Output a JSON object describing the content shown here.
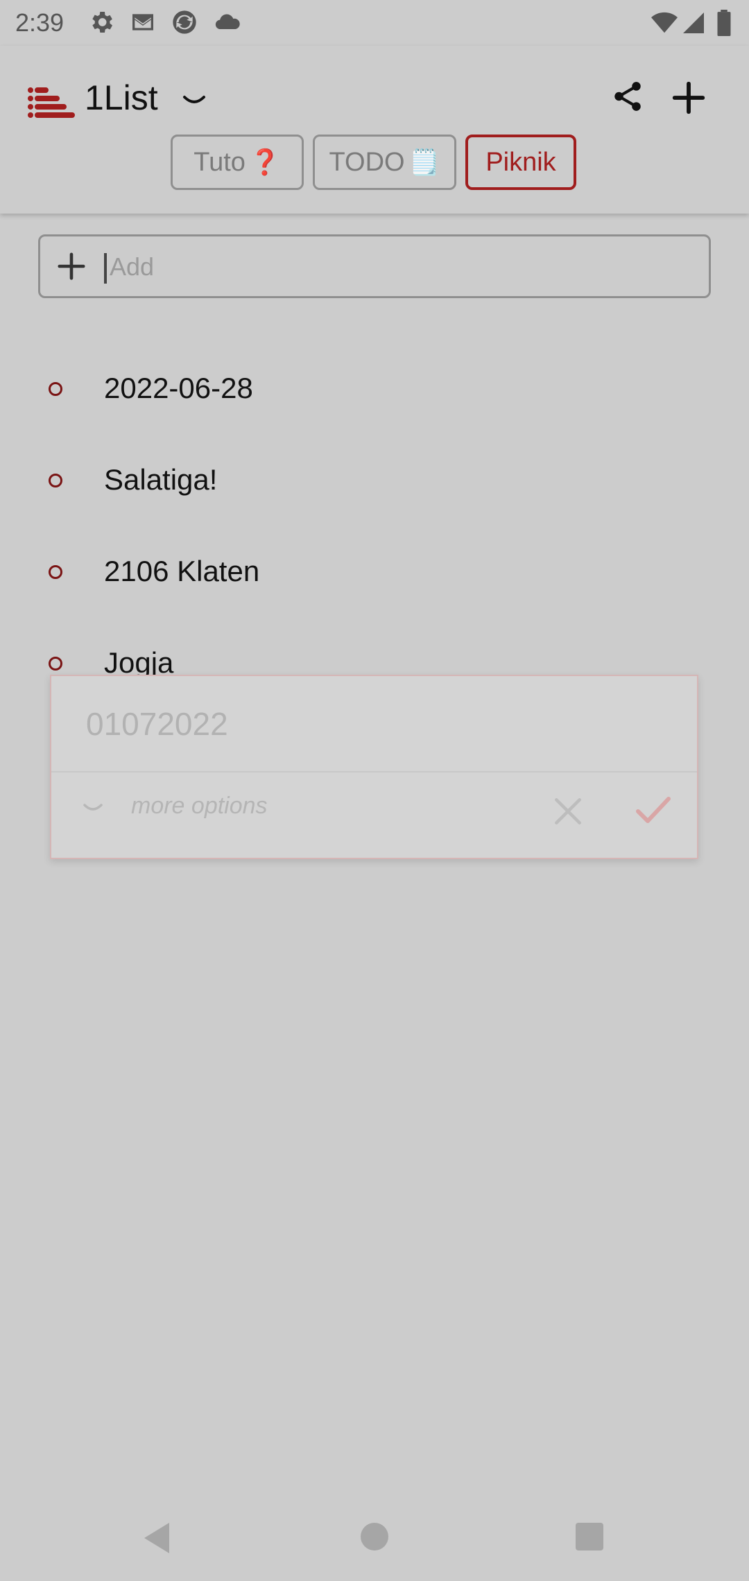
{
  "status_bar": {
    "time": "2:39",
    "icons": [
      "settings-icon",
      "gmail-icon",
      "sync-app-icon",
      "cloud-icon",
      "wifi-icon",
      "signal-icon",
      "battery-icon"
    ]
  },
  "app_bar": {
    "title": "1List",
    "icons": [
      "list-logo-icon",
      "chevron-down-icon",
      "share-icon",
      "plus-icon"
    ]
  },
  "tabs": [
    {
      "label": "Tuto",
      "emoji": "❓",
      "active": false
    },
    {
      "label": "TODO",
      "emoji": "🗒️",
      "active": false
    },
    {
      "label": "Piknik",
      "emoji": "",
      "active": true
    }
  ],
  "add_field": {
    "placeholder": "Add",
    "value": ""
  },
  "list": {
    "items": [
      {
        "text": "2022-06-28"
      },
      {
        "text": "Salatiga!"
      },
      {
        "text": "2106 Klaten"
      },
      {
        "text": "Jogja"
      }
    ]
  },
  "edit_popup": {
    "value": "01072022",
    "more_options_label": "more options"
  },
  "colors": {
    "accent": "#a01d1d",
    "background": "#cccccc",
    "bullet": "#7a1414"
  }
}
